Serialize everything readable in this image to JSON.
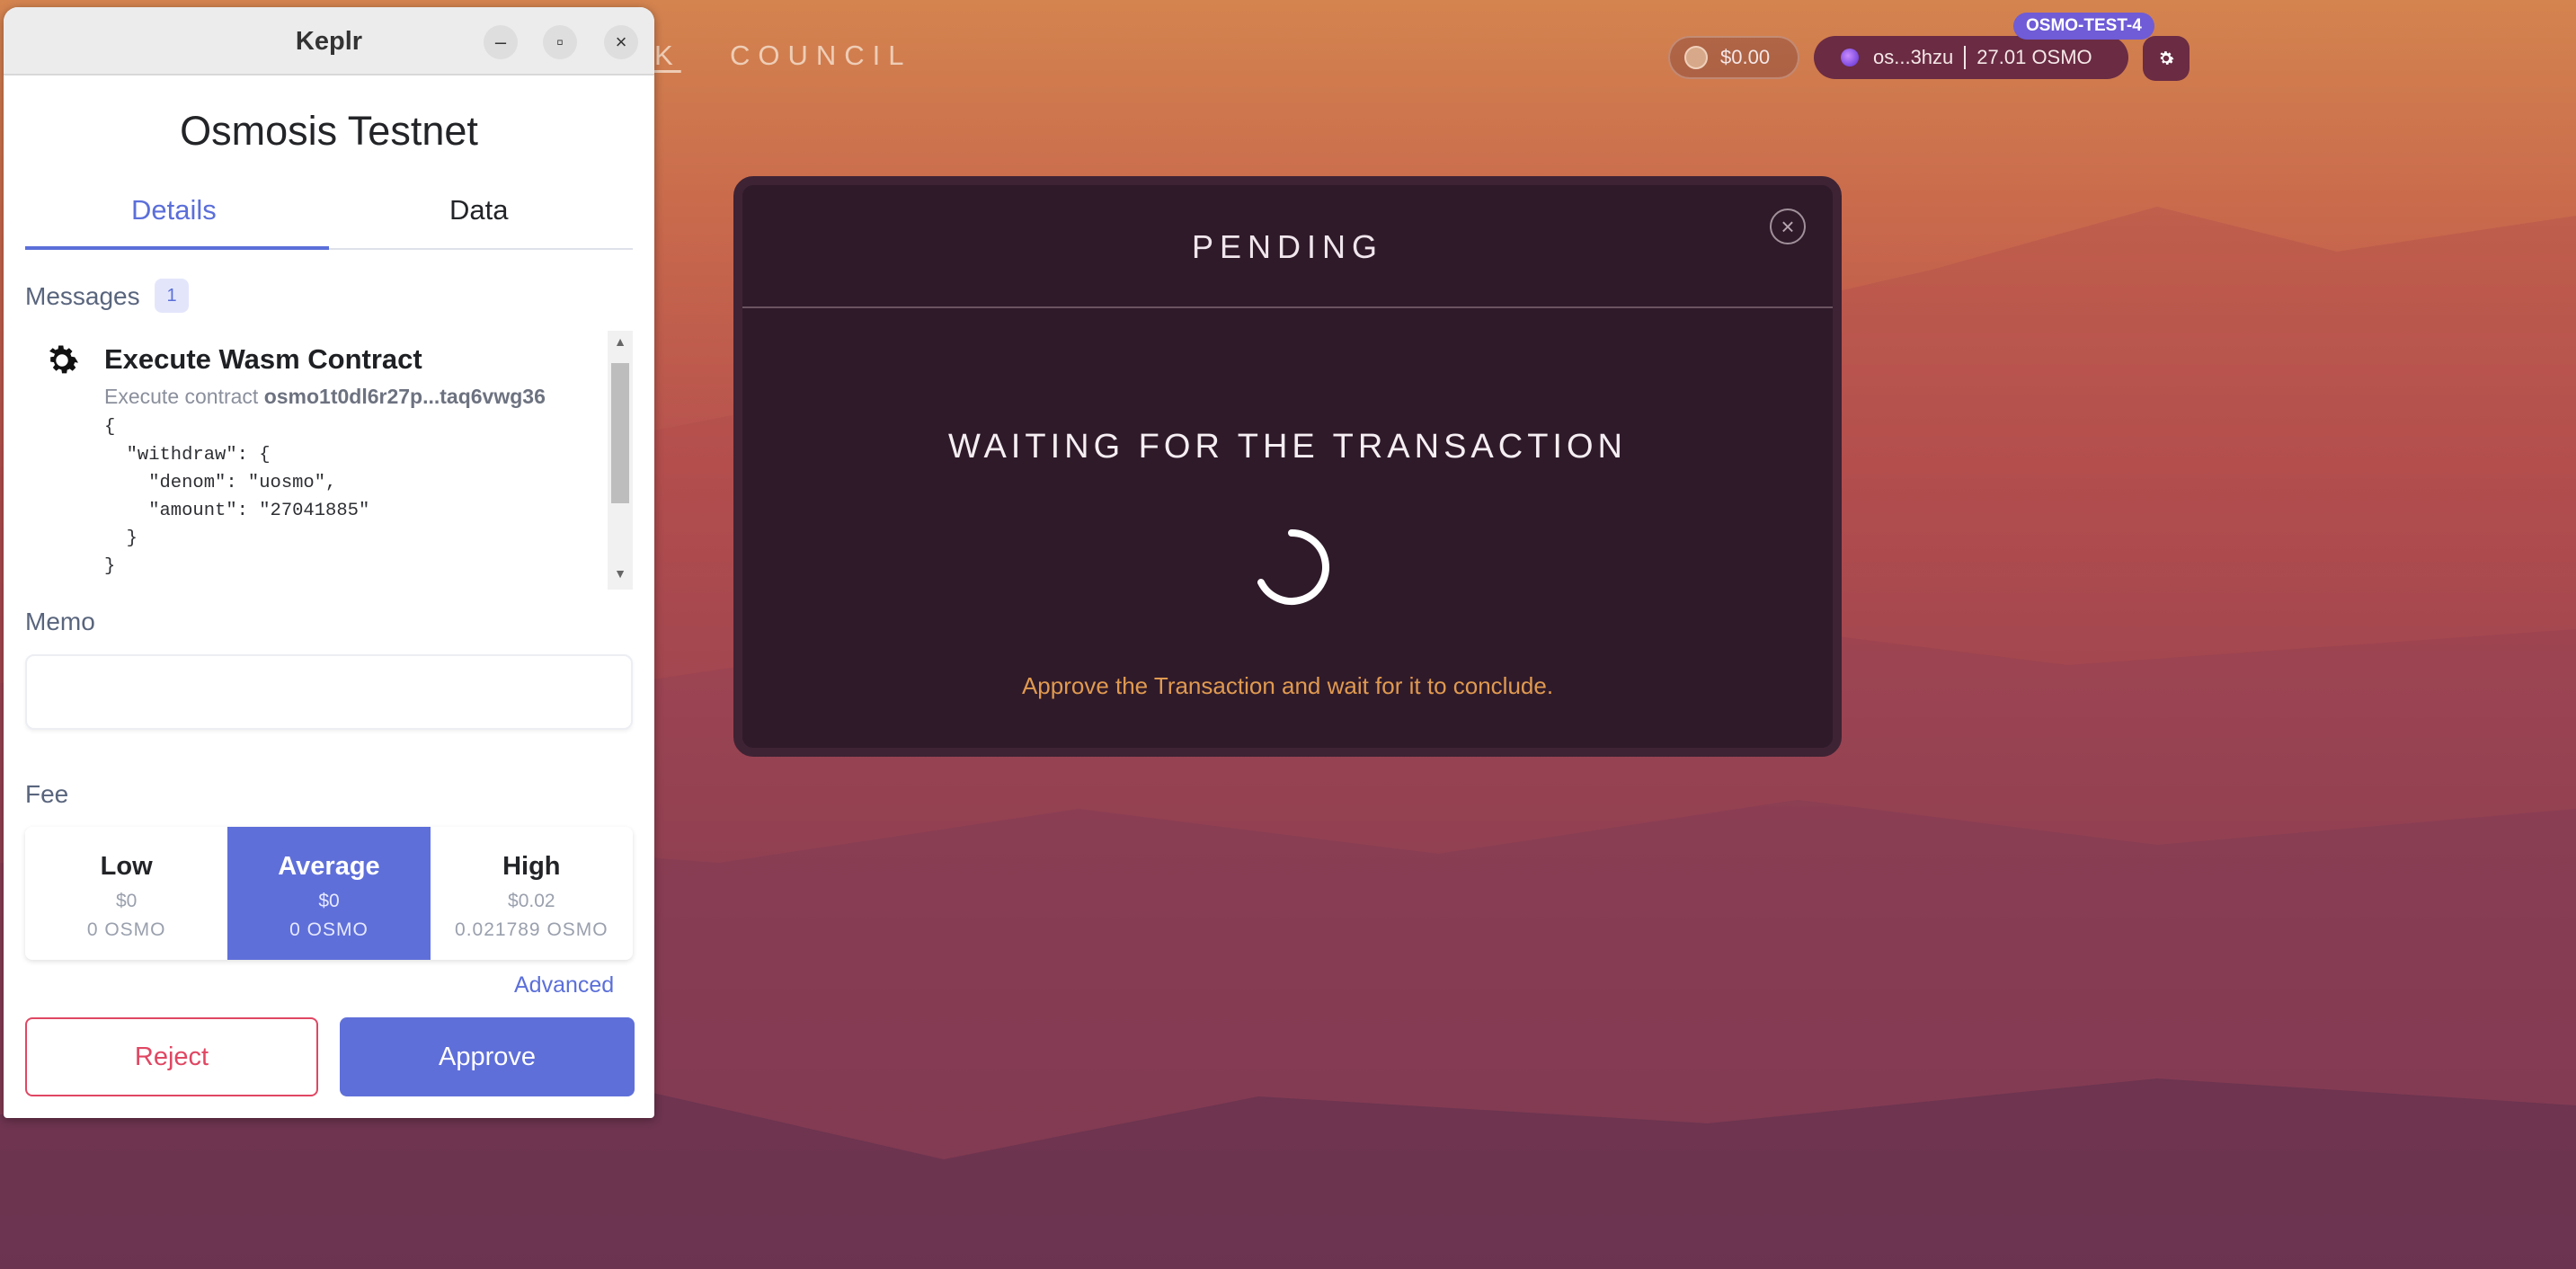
{
  "nav": {
    "links": [
      "K",
      "COUNCIL"
    ]
  },
  "header": {
    "balance": "$0.00",
    "wallet_address": "os...3hzu",
    "wallet_balance": "27.01 OSMO",
    "network_badge": "OSMO-TEST-4"
  },
  "modal": {
    "title": "PENDING",
    "heading": "WAITING FOR THE TRANSACTION",
    "note": "Approve the Transaction and wait for it to conclude.",
    "close_icon": "close-icon"
  },
  "keplr": {
    "window_title": "Keplr",
    "window_buttons": {
      "minimize": "–",
      "maximize": "▫",
      "close": "×"
    },
    "chain_name": "Osmosis Testnet",
    "tabs": [
      "Details",
      "Data"
    ],
    "active_tab": "Details",
    "messages_label": "Messages",
    "messages_count": "1",
    "message": {
      "title": "Execute Wasm Contract",
      "subtitle_prefix": "Execute contract",
      "contract": "osmo1t0dl6r27p...taq6vwg36",
      "code": "{\n  \"withdraw\": {\n    \"denom\": \"uosmo\",\n    \"amount\": \"27041885\"\n  }\n}"
    },
    "memo_label": "Memo",
    "memo_value": "",
    "fee_label": "Fee",
    "fees": [
      {
        "name": "Low",
        "usd": "$0",
        "osmo": "0 OSMO"
      },
      {
        "name": "Average",
        "usd": "$0",
        "osmo": "0 OSMO"
      },
      {
        "name": "High",
        "usd": "$0.02",
        "osmo": "0.021789 OSMO"
      }
    ],
    "selected_fee": "Average",
    "advanced_label": "Advanced",
    "reject_label": "Reject",
    "approve_label": "Approve"
  },
  "colors": {
    "accent": "#5f6fd9",
    "reject": "#e04763",
    "modal_bg": "#2f1a2a",
    "note": "#e09a50"
  }
}
